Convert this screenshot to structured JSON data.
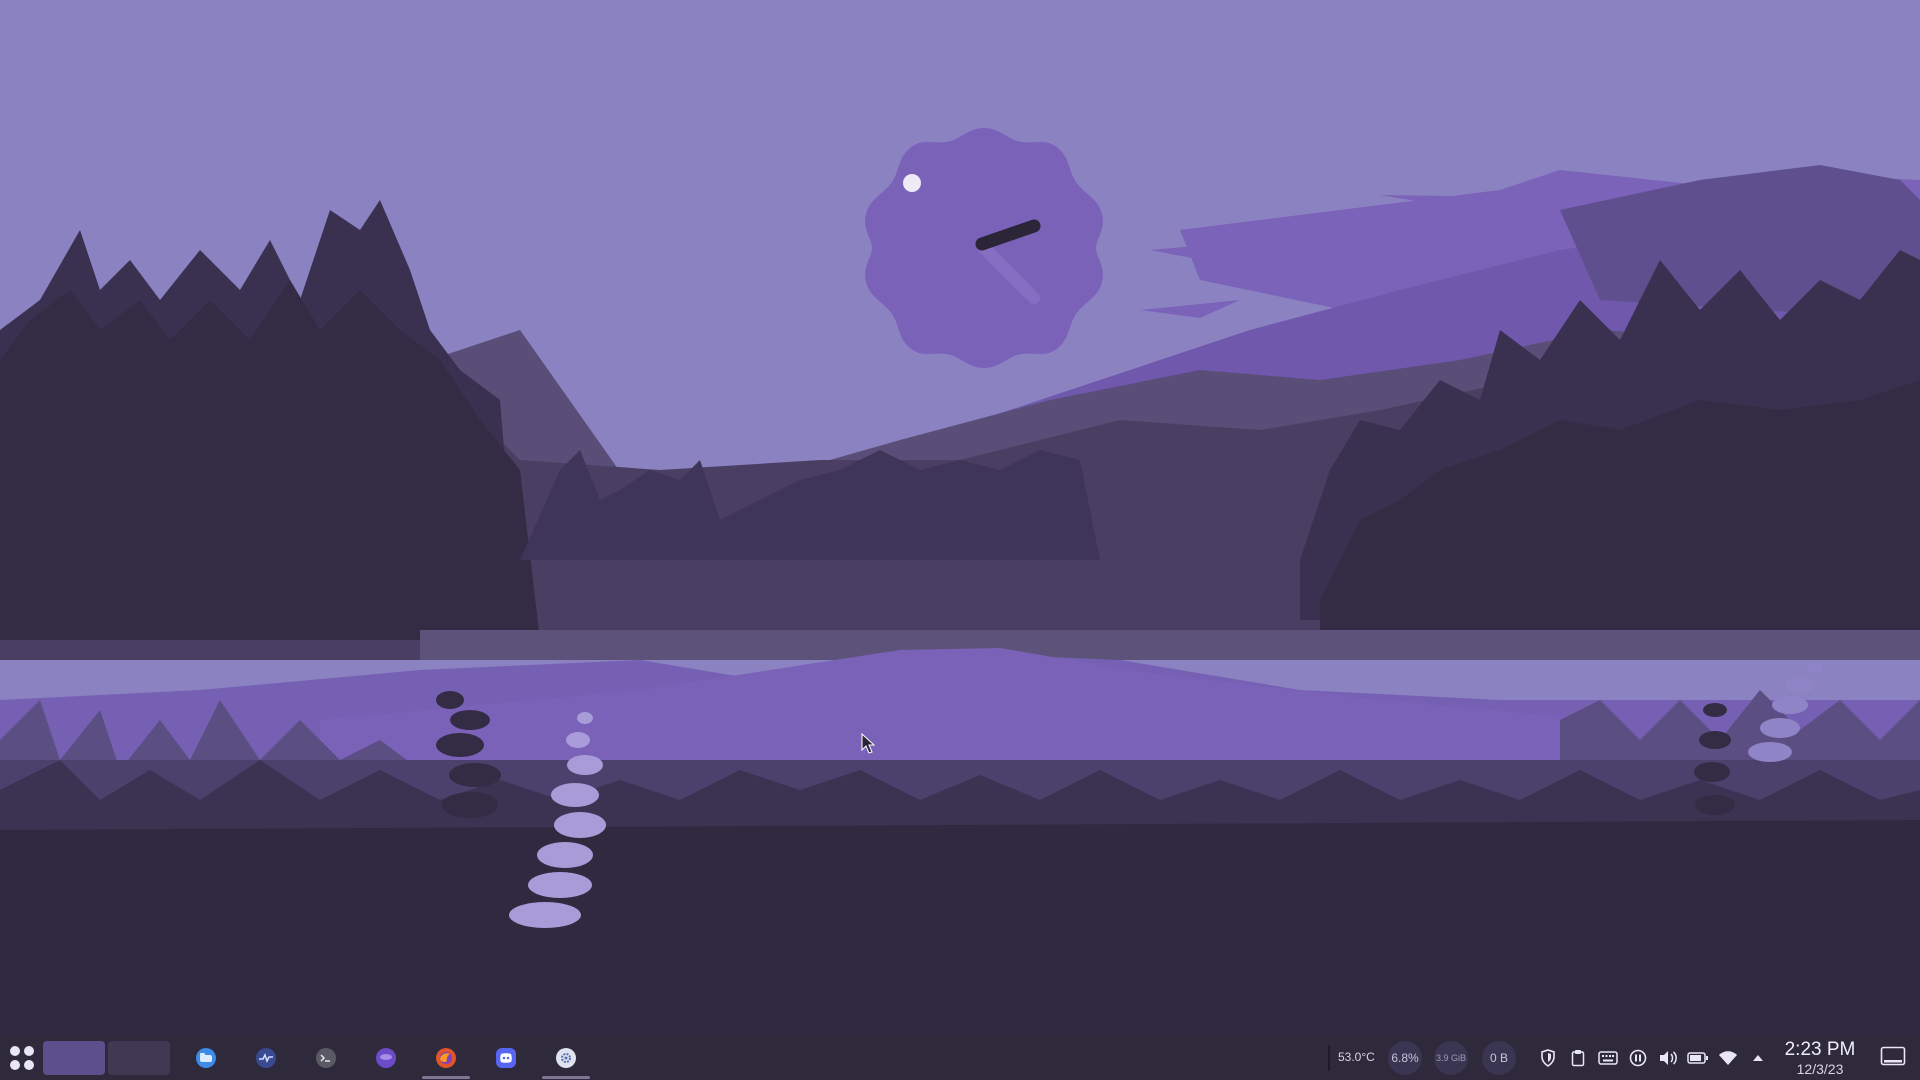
{
  "desktop": {
    "wallpaper": "purple-forest-lake-landscape",
    "colors": {
      "sky": "#8b82c2",
      "clock_face": "#7a62b8",
      "water": "#7660b4",
      "trees_dark": "#342c44",
      "taskbar": "#2e2a3c"
    }
  },
  "taskbar": {
    "launcher_icon": "app-grid-icon",
    "virtual_desktops": [
      "",
      ""
    ],
    "tasks": [
      {
        "icon": "file-manager-icon",
        "color": "#3d8be6",
        "active": false
      },
      {
        "icon": "system-monitor-icon",
        "color": "#3a4a90",
        "active": false
      },
      {
        "icon": "terminal-icon",
        "color": "#5a5a64",
        "active": false
      },
      {
        "icon": "purple-app-icon",
        "color": "#6b4bc8",
        "active": false
      },
      {
        "icon": "firefox-icon",
        "color": "#e0552a",
        "active": true
      },
      {
        "icon": "discord-icon",
        "color": "#5865f2",
        "active": false
      },
      {
        "icon": "settings-icon",
        "color": "#dfe3f0",
        "active": true
      }
    ],
    "system_monitor": {
      "cpu_temp": "53.0°C",
      "cpu_usage": "6.8%",
      "memory": "3.9 GiB",
      "network": "0 B"
    },
    "tray_icons": [
      "shield-icon",
      "clipboard-icon",
      "keyboard-icon",
      "media-pause-icon",
      "volume-icon",
      "battery-icon",
      "wifi-icon",
      "expand-tray-icon"
    ],
    "clock": {
      "time": "2:23 PM",
      "date": "12/3/23"
    },
    "show_desktop_icon": "show-desktop-icon"
  }
}
